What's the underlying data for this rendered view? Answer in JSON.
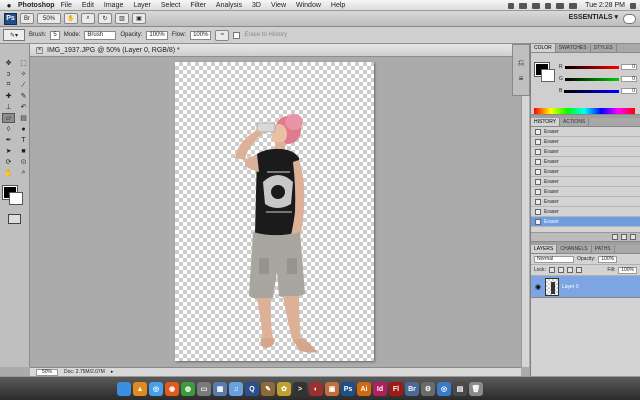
{
  "menubar": {
    "app": "Photoshop",
    "items": [
      "File",
      "Edit",
      "Image",
      "Layer",
      "Select",
      "Filter",
      "Analysis",
      "3D",
      "View",
      "Window",
      "Help"
    ],
    "clock": "Tue 2:28 PM"
  },
  "appbar": {
    "badge": "Ps",
    "zoom": "50%",
    "workspace": "ESSENTIALS ▾"
  },
  "options": {
    "brush_label": "Brush:",
    "brush_size": "5",
    "mode_label": "Mode:",
    "mode_value": "Brush",
    "opacity_label": "Opacity:",
    "opacity_value": "100%",
    "flow_label": "Flow:",
    "flow_value": "100%",
    "erase_history": "Erase to History"
  },
  "document": {
    "tab_title": "IMG_1937.JPG @ 50% (Layer 0, RGB/8) *",
    "status_zoom": "50%",
    "status_doc": "Doc: 2.75M/2.07M"
  },
  "color_panel": {
    "tabs": [
      "COLOR",
      "SWATCHES",
      "STYLES"
    ],
    "sliders": [
      {
        "label": "R",
        "value": "0",
        "color": "#d02020"
      },
      {
        "label": "G",
        "value": "0",
        "color": "#20a020"
      },
      {
        "label": "B",
        "value": "0",
        "color": "#2030d0"
      }
    ]
  },
  "history_panel": {
    "tabs": [
      "HISTORY",
      "ACTIONS"
    ],
    "items": [
      "Eraser",
      "Eraser",
      "Eraser",
      "Eraser",
      "Eraser",
      "Eraser",
      "Eraser",
      "Eraser",
      "Eraser",
      "Eraser"
    ],
    "active_index": 9
  },
  "layers_panel": {
    "tabs": [
      "LAYERS",
      "CHANNELS",
      "PATHS"
    ],
    "blend_mode": "Normal",
    "opacity_label": "Opacity:",
    "opacity_value": "100%",
    "lock_label": "Lock:",
    "fill_label": "Fill:",
    "fill_value": "100%",
    "layer_name": "Layer 0"
  },
  "dock_apps": [
    {
      "name": "finder",
      "color": "#3b8fe0",
      "glyph": ""
    },
    {
      "name": "vlc",
      "color": "#e08a20",
      "glyph": "▲"
    },
    {
      "name": "safari",
      "color": "#4aa0e8",
      "glyph": "◎"
    },
    {
      "name": "firefox",
      "color": "#e05a1a",
      "glyph": "◉"
    },
    {
      "name": "chrome",
      "color": "#3c9c3c",
      "glyph": "◍"
    },
    {
      "name": "app-window",
      "color": "#7a7a7a",
      "glyph": "▭"
    },
    {
      "name": "app-grid",
      "color": "#5a7ab0",
      "glyph": "▦"
    },
    {
      "name": "itunes",
      "color": "#6aa0e0",
      "glyph": "♫"
    },
    {
      "name": "quicktime",
      "color": "#2a4f8a",
      "glyph": "Q"
    },
    {
      "name": "app-tools",
      "color": "#8a6a3a",
      "glyph": "✎"
    },
    {
      "name": "app-flower",
      "color": "#c0a030",
      "glyph": "✿"
    },
    {
      "name": "app-terminal",
      "color": "#333333",
      "glyph": ">"
    },
    {
      "name": "app-disk",
      "color": "#9a3030",
      "glyph": "◐"
    },
    {
      "name": "app-gallery",
      "color": "#c07040",
      "glyph": "▣"
    },
    {
      "name": "photoshop",
      "color": "#1f4f86",
      "glyph": "Ps"
    },
    {
      "name": "illustrator",
      "color": "#d06a10",
      "glyph": "Ai"
    },
    {
      "name": "indesign",
      "color": "#b0205a",
      "glyph": "Id"
    },
    {
      "name": "flash",
      "color": "#a01818",
      "glyph": "Fl"
    },
    {
      "name": "app-bridge",
      "color": "#4a6a9a",
      "glyph": "Br"
    },
    {
      "name": "app-gear",
      "color": "#6a6a6a",
      "glyph": "⚙"
    },
    {
      "name": "app-globe",
      "color": "#3a78c8",
      "glyph": "◎"
    },
    {
      "name": "app-photos",
      "color": "#4a4a4a",
      "glyph": "▤"
    },
    {
      "name": "trash",
      "color": "#8a8a8a",
      "glyph": "🗑"
    }
  ]
}
